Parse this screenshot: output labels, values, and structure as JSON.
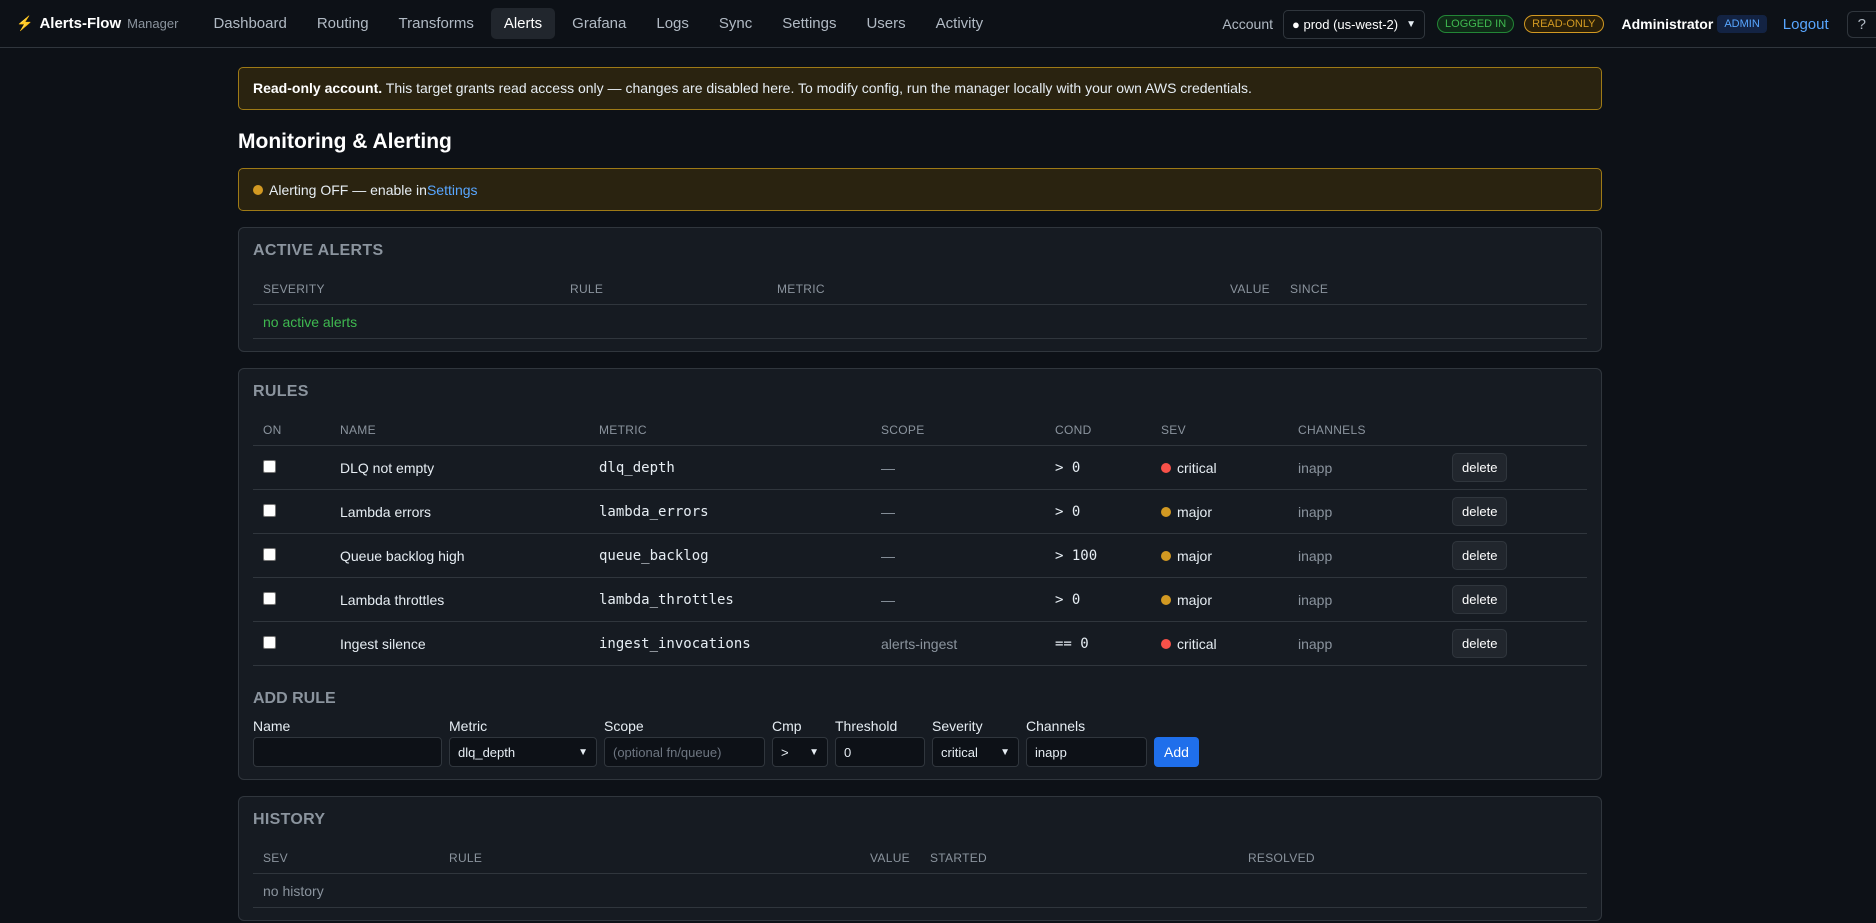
{
  "app": {
    "name": "Alerts-Flow",
    "sub": "Manager"
  },
  "nav": {
    "items": [
      "Dashboard",
      "Routing",
      "Transforms",
      "Alerts",
      "Grafana",
      "Logs",
      "Sync",
      "Settings",
      "Users",
      "Activity"
    ],
    "active": "Alerts"
  },
  "account": {
    "label": "Account",
    "selected": "● prod (us-west-2)",
    "status_badge": "LOGGED IN",
    "mode_badge": "READ-ONLY"
  },
  "user": {
    "name": "Administrator",
    "role": "ADMIN",
    "logout": "Logout",
    "help": "?"
  },
  "banner_readonly": {
    "bold": "Read-only account.",
    "text": " This target grants read access only — changes are disabled here. To modify config, run the manager locally with your own AWS credentials."
  },
  "page_title": "Monitoring & Alerting",
  "alerting_banner": {
    "text": "Alerting OFF — enable in ",
    "link": "Settings"
  },
  "active_alerts": {
    "title": "ACTIVE ALERTS",
    "columns": [
      "SEVERITY",
      "RULE",
      "METRIC",
      "VALUE",
      "SINCE"
    ],
    "empty": "no active alerts"
  },
  "rules": {
    "title": "RULES",
    "columns": [
      "ON",
      "NAME",
      "METRIC",
      "SCOPE",
      "COND",
      "SEV",
      "CHANNELS",
      ""
    ],
    "rows": [
      {
        "name": "DLQ not empty",
        "metric": "dlq_depth",
        "scope": "—",
        "cond": "> 0",
        "sev": "critical",
        "sev_color": "#f85149",
        "channels": "inapp",
        "action": "delete"
      },
      {
        "name": "Lambda errors",
        "metric": "lambda_errors",
        "scope": "—",
        "cond": "> 0",
        "sev": "major",
        "sev_color": "#d29922",
        "channels": "inapp",
        "action": "delete"
      },
      {
        "name": "Queue backlog high",
        "metric": "queue_backlog",
        "scope": "—",
        "cond": "> 100",
        "sev": "major",
        "sev_color": "#d29922",
        "channels": "inapp",
        "action": "delete"
      },
      {
        "name": "Lambda throttles",
        "metric": "lambda_throttles",
        "scope": "—",
        "cond": "> 0",
        "sev": "major",
        "sev_color": "#d29922",
        "channels": "inapp",
        "action": "delete"
      },
      {
        "name": "Ingest silence",
        "metric": "ingest_invocations",
        "scope": "alerts-ingest",
        "cond": "== 0",
        "sev": "critical",
        "sev_color": "#f85149",
        "channels": "inapp",
        "action": "delete"
      }
    ]
  },
  "add_rule": {
    "title": "ADD RULE",
    "name_label": "Name",
    "name_value": "",
    "metric_label": "Metric",
    "metric_value": "dlq_depth",
    "scope_label": "Scope",
    "scope_placeholder": "(optional fn/queue)",
    "cmp_label": "Cmp",
    "cmp_value": ">",
    "threshold_label": "Threshold",
    "threshold_value": "0",
    "severity_label": "Severity",
    "severity_value": "critical",
    "channels_label": "Channels",
    "channels_value": "inapp",
    "add_button": "Add"
  },
  "history": {
    "title": "HISTORY",
    "columns": [
      "SEV",
      "RULE",
      "VALUE",
      "STARTED",
      "RESOLVED"
    ],
    "empty": "no history"
  }
}
